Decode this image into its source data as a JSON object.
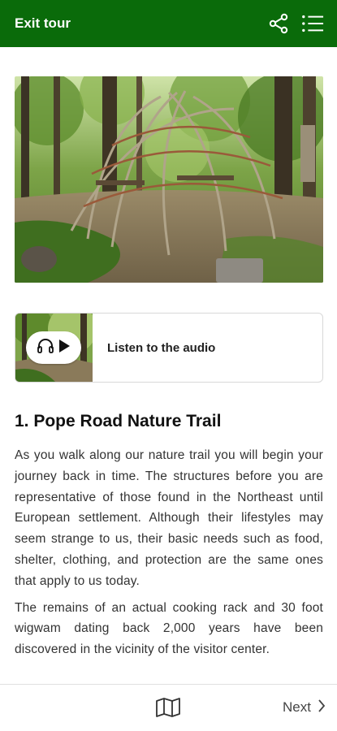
{
  "topbar": {
    "exit_label": "Exit tour",
    "background": "#0a6b0a",
    "share_icon": "share-icon",
    "list_icon": "list-icon"
  },
  "hero": {
    "image_subject": "wigwam frame in forest"
  },
  "audio": {
    "label": "Listen to the audio",
    "headphones_icon": "headphones-icon",
    "play_icon": "play-icon"
  },
  "stop": {
    "title": "1. Pope Road Nature Trail",
    "paragraphs": [
      "As you walk along our nature trail you will begin your journey back in time. The structures before you are representative of those found in the Northeast until European settlement. Although their lifestyles may seem strange to us, their basic needs such as food, shelter, clothing, and protection are the same ones that apply to us today.",
      "The remains of an actual cooking rack and 30 foot wigwam dating back 2,000 years have been discovered in the vicinity of the visitor center."
    ]
  },
  "bottombar": {
    "map_icon": "map-icon",
    "next_label": "Next",
    "chevron_icon": "chevron-right-icon"
  }
}
